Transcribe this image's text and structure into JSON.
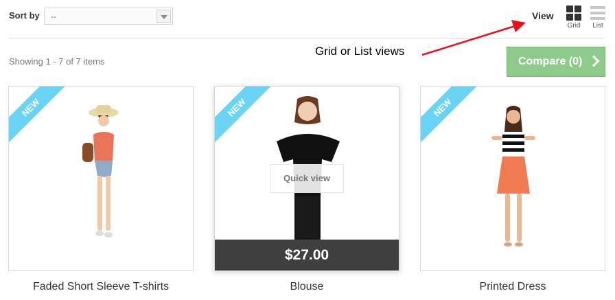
{
  "toolbar": {
    "sort_label": "Sort by",
    "sort_value": "--",
    "view_label": "View",
    "view_grid_label": "Grid",
    "view_list_label": "List"
  },
  "annotation": {
    "text": "Grid or List views",
    "arrow_color": "#e8101c"
  },
  "results": {
    "showing_text": "Showing 1 - 7 of 7 items"
  },
  "compare": {
    "label": "Compare (0)",
    "color": "#8ecb8a"
  },
  "products": [
    {
      "name": "Faded Short Sleeve T-shirts",
      "badge": "NEW"
    },
    {
      "name": "Blouse",
      "badge": "NEW",
      "quick_view": "Quick view",
      "price": "$27.00"
    },
    {
      "name": "Printed Dress",
      "badge": "NEW"
    }
  ],
  "colors": {
    "badge": "#6ad4f5",
    "price_bar": "#3f3f3f"
  }
}
